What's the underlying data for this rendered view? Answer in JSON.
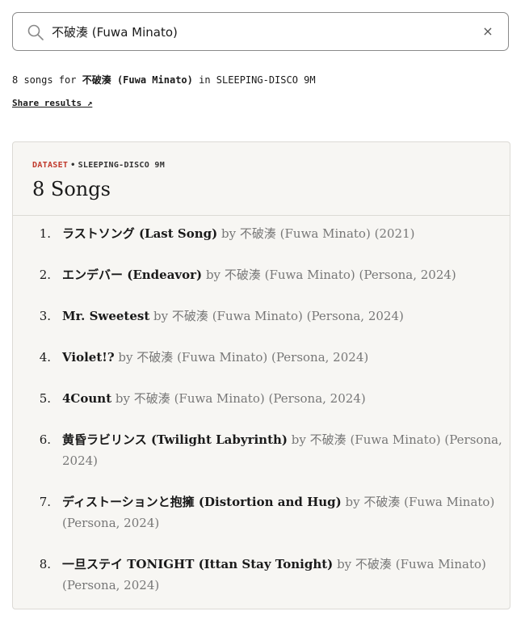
{
  "search": {
    "value": "不破湊 (Fuwa Minato)",
    "placeholder": "",
    "clear_label": "×"
  },
  "summary": {
    "prefix": "8 songs for",
    "query": "不破湊 (Fuwa Minato)",
    "middle": "in",
    "dataset": "SLEEPING-DISCO 9M"
  },
  "share": {
    "label": "Share results ↗"
  },
  "card": {
    "dataset_label": "DATASET",
    "separator": "•",
    "dataset_name": "SLEEPING-DISCO 9M",
    "title": "8 Songs"
  },
  "songs": [
    {
      "num": "1.",
      "title_jp": "ラストソング",
      "title_en": "(Last Song)",
      "by": "by",
      "artist_jp": "不破湊",
      "artist_en": "(Fuwa Minato)",
      "meta": "(2021)"
    },
    {
      "num": "2.",
      "title_jp": "エンデバー",
      "title_en": "(Endeavor)",
      "by": "by",
      "artist_jp": "不破湊",
      "artist_en": "(Fuwa Minato)",
      "meta": "(Persona, 2024)"
    },
    {
      "num": "3.",
      "title_jp": "",
      "title_en": "Mr. Sweetest",
      "by": "by",
      "artist_jp": "不破湊",
      "artist_en": "(Fuwa Minato)",
      "meta": "(Persona, 2024)"
    },
    {
      "num": "4.",
      "title_jp": "",
      "title_en": "Violet!?",
      "by": "by",
      "artist_jp": "不破湊",
      "artist_en": "(Fuwa Minato)",
      "meta": "(Persona, 2024)"
    },
    {
      "num": "5.",
      "title_jp": "",
      "title_en": "4Count",
      "by": "by",
      "artist_jp": "不破湊",
      "artist_en": "(Fuwa Minato)",
      "meta": "(Persona, 2024)"
    },
    {
      "num": "6.",
      "title_jp": "黄昏ラビリンス",
      "title_en": "(Twilight Labyrinth)",
      "by": "by",
      "artist_jp": "不破湊",
      "artist_en": "(Fuwa Minato)",
      "meta": "(Persona, 2024)"
    },
    {
      "num": "7.",
      "title_jp": "ディストーションと抱擁",
      "title_en": "(Distortion and Hug)",
      "by": "by",
      "artist_jp": "不破湊",
      "artist_en": "(Fuwa Minato)",
      "meta": "(Persona, 2024)"
    },
    {
      "num": "8.",
      "title_jp": "一旦ステイ",
      "title_en": "TONIGHT (Ittan Stay Tonight)",
      "by": "by",
      "artist_jp": "不破湊",
      "artist_en": "(Fuwa Minato)",
      "meta": "(Persona, 2024)"
    }
  ]
}
